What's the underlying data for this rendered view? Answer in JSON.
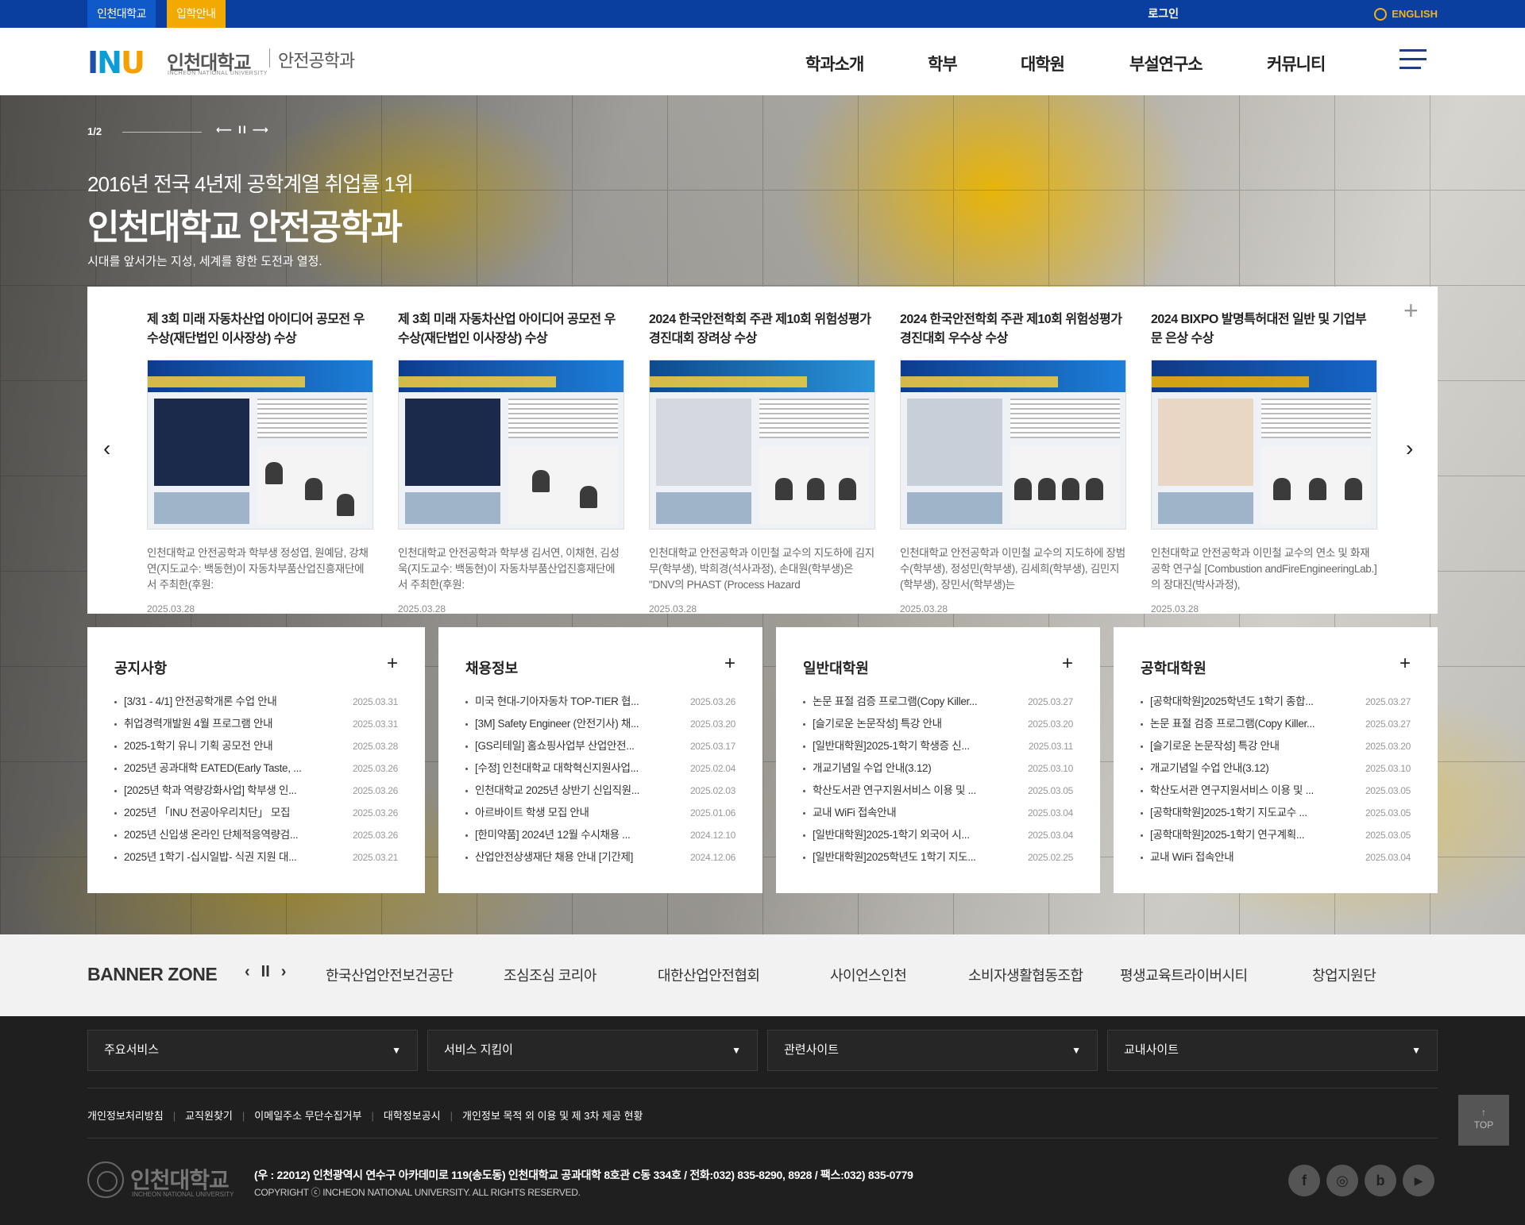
{
  "topbar": {
    "univ_tab": "인천대학교",
    "admission_tab": "입학안내",
    "login": "로그인",
    "english": "ENGLISH"
  },
  "logo": {
    "mark": "INU",
    "name": "인천대학교",
    "name_en": "INCHEON NATIONAL UNIVERSITY",
    "dept": "안전공학과"
  },
  "nav": {
    "items": [
      "학과소개",
      "학부",
      "대학원",
      "부설연구소",
      "커뮤니티"
    ]
  },
  "hero": {
    "pager": "1/2",
    "controls": "⟵ II ⟶",
    "subtitle": "2016년 전국 4년제 공학계열 취업률 1위",
    "title": "인천대학교 안전공학과",
    "desc": "시대를 앞서가는 지성, 세계를 향한 도전과 열정."
  },
  "news": {
    "items": [
      {
        "title": "제 3회 미래 자동차산업 아이디어 공모전 우수상(재단법인 이사장상) 수상",
        "desc": "인천대학교 안전공학과 학부생 정성엽, 원예담, 강채연(지도교수: 백동현)이 자동차부품산업진흥재단에서 주최한(후원:",
        "date": "2025.03.28"
      },
      {
        "title": "제 3회 미래 자동차산업 아이디어 공모전 우수상(재단법인 이사장상) 수상",
        "desc": "인천대학교 안전공학과 학부생 김서연, 이채현, 김성욱(지도교수: 백동현)이 자동차부품산업진흥재단에서 주최한(후원:",
        "date": "2025.03.28"
      },
      {
        "title": "2024 한국안전학회 주관 제10회 위험성평가 경진대회 장려상 수상",
        "desc": "인천대학교 안전공학과 이민철 교수의 지도하에 김지무(학부생), 박희경(석사과정), 손대원(학부생)은 \"DNV의 PHAST (Process Hazard",
        "date": "2025.03.28"
      },
      {
        "title": "2024 한국안전학회 주관 제10회 위험성평가 경진대회 우수상 수상",
        "desc": "인천대학교 안전공학과 이민철 교수의 지도하에 장범수(학부생), 정성민(학부생), 김세희(학부생), 김민지(학부생), 장민서(학부생)는",
        "date": "2025.03.28"
      },
      {
        "title": "2024 BIXPO 발명특허대전 일반 및 기업부문 은상 수상",
        "desc": "인천대학교 안전공학과 이민철 교수의 연소 및 화재공학 연구실 [Combustion andFireEngineeringLab.] 의 장대진(박사과정),",
        "date": "2025.03.28"
      }
    ],
    "prev": "‹",
    "next": "›",
    "more": "+"
  },
  "boards": [
    {
      "title": "공지사항",
      "more": "+",
      "items": [
        {
          "t": "[3/31 - 4/1] 안전공학개론 수업 안내",
          "d": "2025.03.31"
        },
        {
          "t": "취업경력개발원 4월 프로그램 안내",
          "d": "2025.03.31"
        },
        {
          "t": "2025-1학기 유니 기획 공모전 안내",
          "d": "2025.03.28"
        },
        {
          "t": "2025년 공과대학 EATED(Early Taste, ...",
          "d": "2025.03.26"
        },
        {
          "t": "[2025년 학과 역량강화사업] 학부생 인...",
          "d": "2025.03.26"
        },
        {
          "t": "2025년 「INU 전공아우리치단」 모집",
          "d": "2025.03.26"
        },
        {
          "t": "2025년 신입생 온라인 단체적응역량검...",
          "d": "2025.03.26"
        },
        {
          "t": "2025년 1학기 -십시일밥- 식권 지원 대...",
          "d": "2025.03.21"
        }
      ]
    },
    {
      "title": "채용정보",
      "more": "+",
      "items": [
        {
          "t": "미국 현대-기아자동차 TOP-TIER 협...",
          "d": "2025.03.26"
        },
        {
          "t": "[3M] Safety Engineer (안전기사) 채...",
          "d": "2025.03.20"
        },
        {
          "t": "[GS리테일] 홈쇼핑사업부 산업안전...",
          "d": "2025.03.17"
        },
        {
          "t": "[수정] 인천대학교 대학혁신지원사업...",
          "d": "2025.02.04"
        },
        {
          "t": "인천대학교 2025년 상반기 신입직원...",
          "d": "2025.02.03"
        },
        {
          "t": "아르바이트 학생 모집 안내",
          "d": "2025.01.06"
        },
        {
          "t": "[한미약품] 2024년 12월 수시채용 ...",
          "d": "2024.12.10"
        },
        {
          "t": "산업안전상생재단 채용 안내 [기간제]",
          "d": "2024.12.06"
        }
      ]
    },
    {
      "title": "일반대학원",
      "more": "+",
      "items": [
        {
          "t": "논문 표절 검증 프로그램(Copy Killer...",
          "d": "2025.03.27"
        },
        {
          "t": "[슬기로운 논문작성] 특강 안내",
          "d": "2025.03.20"
        },
        {
          "t": "[일반대학원]2025-1학기 학생증 신...",
          "d": "2025.03.11"
        },
        {
          "t": "개교기념일 수업 안내(3.12)",
          "d": "2025.03.10"
        },
        {
          "t": "학산도서관 연구지원서비스 이용 및 ...",
          "d": "2025.03.05"
        },
        {
          "t": "교내 WiFi 접속안내",
          "d": "2025.03.04"
        },
        {
          "t": "[일반대학원]2025-1학기 외국어 시...",
          "d": "2025.03.04"
        },
        {
          "t": "[일반대학원]2025학년도 1학기 지도...",
          "d": "2025.02.25"
        }
      ]
    },
    {
      "title": "공학대학원",
      "more": "+",
      "items": [
        {
          "t": "[공학대학원]2025학년도 1학기 종합...",
          "d": "2025.03.27"
        },
        {
          "t": "논문 표절 검증 프로그램(Copy Killer...",
          "d": "2025.03.27"
        },
        {
          "t": "[슬기로운 논문작성] 특강 안내",
          "d": "2025.03.20"
        },
        {
          "t": "개교기념일 수업 안내(3.12)",
          "d": "2025.03.10"
        },
        {
          "t": "학산도서관 연구지원서비스 이용 및 ...",
          "d": "2025.03.05"
        },
        {
          "t": "[공학대학원]2025-1학기 지도교수 ...",
          "d": "2025.03.05"
        },
        {
          "t": "[공학대학원]2025-1학기 연구계획...",
          "d": "2025.03.05"
        },
        {
          "t": "교내 WiFi 접속안내",
          "d": "2025.03.04"
        }
      ]
    }
  ],
  "banner": {
    "title": "BANNER ZONE",
    "controls": [
      "‹",
      "II",
      "›"
    ],
    "items": [
      "한국산업안전보건공단",
      "조심조심 코리아",
      "대한산업안전협회",
      "사이언스인천",
      "소비자생활협동조합",
      "평생교육트라이버시티",
      "창업지원단"
    ]
  },
  "footer": {
    "selects": [
      "주요서비스",
      "서비스 지킴이",
      "관련사이트",
      "교내사이트"
    ],
    "select_arrow": "▼",
    "links": [
      "개인정보처리방침",
      "교직원찾기",
      "이메일주소 무단수집거부",
      "대학정보공시",
      "개인정보 목적 외 이용 및 제 3차 제공 현황"
    ],
    "logo_name": "인천대학교",
    "logo_en": "INCHEON NATIONAL UNIVERSITY",
    "address": "(우 : 22012) 인천광역시 연수구 아카데미로 119(송도동) 인천대학교 공과대학 8호관 C동 334호  /  전화:032) 835-8290, 8928  /  팩스:032) 835-0779",
    "copyright": "COPYRIGHT ⓒ INCHEON NATIONAL UNIVERSITY. ALL RIGHTS RESERVED.",
    "sns": [
      {
        "name": "facebook-icon",
        "glyph": "f"
      },
      {
        "name": "instagram-icon",
        "glyph": "◎"
      },
      {
        "name": "blog-icon",
        "glyph": "b"
      },
      {
        "name": "youtube-icon",
        "glyph": "▶"
      }
    ],
    "top_arrow": "↑",
    "top_label": "TOP"
  }
}
